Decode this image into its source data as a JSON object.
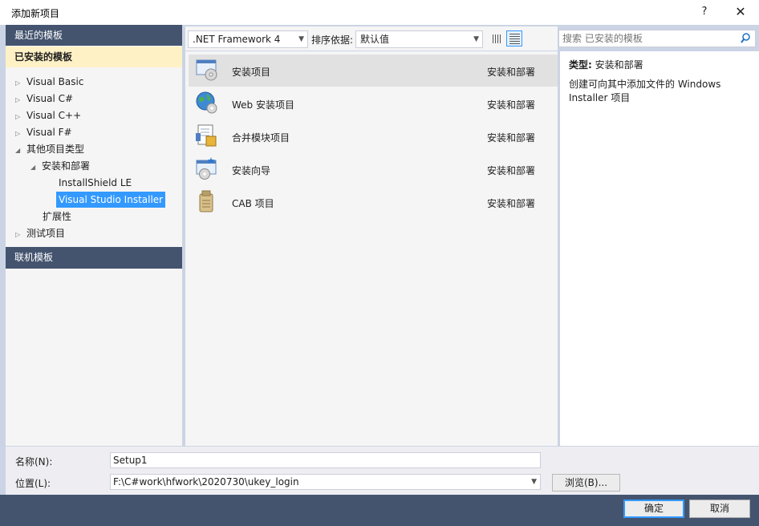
{
  "window": {
    "title": "添加新项目",
    "help": "?",
    "close": "✕"
  },
  "left": {
    "recent_header": "最近的模板",
    "installed_header": "已安装的模板",
    "online_header": "联机模板",
    "tree": [
      {
        "label": "Visual Basic",
        "arrow": "▷"
      },
      {
        "label": "Visual C#",
        "arrow": "▷"
      },
      {
        "label": "Visual C++",
        "arrow": "▷"
      },
      {
        "label": "Visual F#",
        "arrow": "▷"
      },
      {
        "label": "其他项目类型",
        "arrow": "◢"
      },
      {
        "label": "安装和部署",
        "arrow": "◢"
      },
      {
        "label": "InstallShield LE",
        "arrow": ""
      },
      {
        "label": "Visual Studio Installer",
        "arrow": ""
      },
      {
        "label": "扩展性",
        "arrow": ""
      },
      {
        "label": "测试项目",
        "arrow": "▷"
      }
    ]
  },
  "toolbar": {
    "framework": ".NET Framework 4",
    "sort_label": "排序依据:",
    "sort_value": "默认值"
  },
  "templates": [
    {
      "name": "安装项目",
      "category": "安装和部署",
      "icon": "setup-project-icon"
    },
    {
      "name": "Web 安装项目",
      "category": "安装和部署",
      "icon": "web-setup-project-icon"
    },
    {
      "name": "合并模块项目",
      "category": "安装和部署",
      "icon": "merge-module-icon"
    },
    {
      "name": "安装向导",
      "category": "安装和部署",
      "icon": "setup-wizard-icon"
    },
    {
      "name": "CAB 项目",
      "category": "安装和部署",
      "icon": "cab-project-icon"
    }
  ],
  "search": {
    "placeholder": "搜索 已安装的模板"
  },
  "details": {
    "type_label": "类型:",
    "type_value": "安装和部署",
    "description": "创建可向其中添加文件的 Windows Installer 项目"
  },
  "form": {
    "name_label": "名称(N):",
    "name_value": "Setup1",
    "location_label": "位置(L):",
    "location_value": "F:\\C#work\\hfwork\\2020730\\ukey_login",
    "browse_label": "浏览(B)..."
  },
  "buttons": {
    "ok": "确定",
    "cancel": "取消"
  },
  "colors": {
    "header_dark": "#44546f",
    "selected_header": "#fff1c6",
    "selection_blue": "#3399ff"
  }
}
